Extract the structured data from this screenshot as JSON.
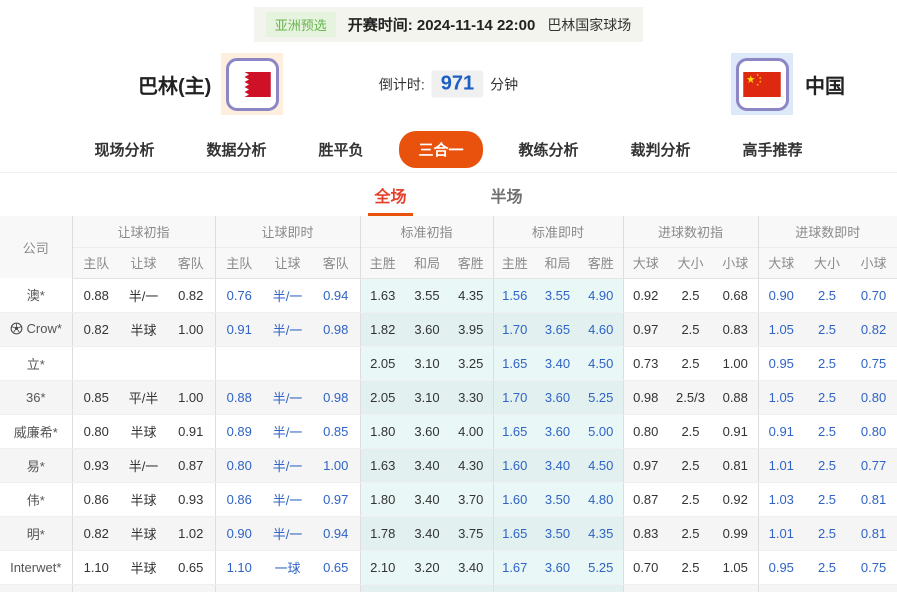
{
  "topbar": {
    "badge": "亚洲预选",
    "kickoff_label": "开赛时间:",
    "kickoff_time": "2024-11-14 22:00",
    "venue": "巴林国家球场"
  },
  "match": {
    "home_name": "巴林(主)",
    "away_name": "中国",
    "home_flag": "bahrain-flag",
    "away_flag": "china-flag",
    "countdown_label": "倒计时:",
    "countdown_value": "971",
    "countdown_unit": "分钟"
  },
  "nav": {
    "items": [
      {
        "label": "现场分析",
        "active": false
      },
      {
        "label": "数据分析",
        "active": false
      },
      {
        "label": "胜平负",
        "active": false
      },
      {
        "label": "三合一",
        "active": true
      },
      {
        "label": "教练分析",
        "active": false
      },
      {
        "label": "裁判分析",
        "active": false
      },
      {
        "label": "高手推荐",
        "active": false
      }
    ]
  },
  "subtabs": {
    "items": [
      {
        "label": "全场",
        "active": true
      },
      {
        "label": "半场",
        "active": false
      }
    ]
  },
  "table": {
    "company_header": "公司",
    "groups": [
      {
        "title": "让球初指",
        "cols": [
          "主队",
          "让球",
          "客队"
        ]
      },
      {
        "title": "让球即时",
        "cols": [
          "主队",
          "让球",
          "客队"
        ]
      },
      {
        "title": "标准初指",
        "cols": [
          "主胜",
          "和局",
          "客胜"
        ]
      },
      {
        "title": "标准即时",
        "cols": [
          "主胜",
          "和局",
          "客胜"
        ]
      },
      {
        "title": "进球数初指",
        "cols": [
          "大球",
          "大小",
          "小球"
        ]
      },
      {
        "title": "进球数即时",
        "cols": [
          "大球",
          "大小",
          "小球"
        ]
      }
    ],
    "rows": [
      {
        "company": "澳*",
        "icon": null,
        "cells": [
          [
            "0.88",
            "半/一",
            "0.82"
          ],
          [
            "0.76",
            "半/一",
            "0.94"
          ],
          [
            "1.63",
            "3.55",
            "4.35"
          ],
          [
            "1.56",
            "3.55",
            "4.90"
          ],
          [
            "0.92",
            "2.5",
            "0.68"
          ],
          [
            "0.90",
            "2.5",
            "0.70"
          ]
        ]
      },
      {
        "company": "Crow*",
        "icon": "soccer-ball",
        "cells": [
          [
            "0.82",
            "半球",
            "1.00"
          ],
          [
            "0.91",
            "半/一",
            "0.98"
          ],
          [
            "1.82",
            "3.60",
            "3.95"
          ],
          [
            "1.70",
            "3.65",
            "4.60"
          ],
          [
            "0.97",
            "2.5",
            "0.83"
          ],
          [
            "1.05",
            "2.5",
            "0.82"
          ]
        ]
      },
      {
        "company": "立*",
        "icon": null,
        "cells": [
          [
            "",
            "",
            ""
          ],
          [
            "",
            "",
            ""
          ],
          [
            "2.05",
            "3.10",
            "3.25"
          ],
          [
            "1.65",
            "3.40",
            "4.50"
          ],
          [
            "0.73",
            "2.5",
            "1.00"
          ],
          [
            "0.95",
            "2.5",
            "0.75"
          ]
        ]
      },
      {
        "company": "36*",
        "icon": null,
        "cells": [
          [
            "0.85",
            "平/半",
            "1.00"
          ],
          [
            "0.88",
            "半/一",
            "0.98"
          ],
          [
            "2.05",
            "3.10",
            "3.30"
          ],
          [
            "1.70",
            "3.60",
            "5.25"
          ],
          [
            "0.98",
            "2.5/3",
            "0.88"
          ],
          [
            "1.05",
            "2.5",
            "0.80"
          ]
        ]
      },
      {
        "company": "威廉希*",
        "icon": null,
        "cells": [
          [
            "0.80",
            "半球",
            "0.91"
          ],
          [
            "0.89",
            "半/一",
            "0.85"
          ],
          [
            "1.80",
            "3.60",
            "4.00"
          ],
          [
            "1.65",
            "3.60",
            "5.00"
          ],
          [
            "0.80",
            "2.5",
            "0.91"
          ],
          [
            "0.91",
            "2.5",
            "0.80"
          ]
        ]
      },
      {
        "company": "易*",
        "icon": null,
        "cells": [
          [
            "0.93",
            "半/一",
            "0.87"
          ],
          [
            "0.80",
            "半/一",
            "1.00"
          ],
          [
            "1.63",
            "3.40",
            "4.30"
          ],
          [
            "1.60",
            "3.40",
            "4.50"
          ],
          [
            "0.97",
            "2.5",
            "0.81"
          ],
          [
            "1.01",
            "2.5",
            "0.77"
          ]
        ]
      },
      {
        "company": "伟*",
        "icon": null,
        "cells": [
          [
            "0.86",
            "半球",
            "0.93"
          ],
          [
            "0.86",
            "半/一",
            "0.97"
          ],
          [
            "1.80",
            "3.40",
            "3.70"
          ],
          [
            "1.60",
            "3.50",
            "4.80"
          ],
          [
            "0.87",
            "2.5",
            "0.92"
          ],
          [
            "1.03",
            "2.5",
            "0.81"
          ]
        ]
      },
      {
        "company": "明*",
        "icon": null,
        "cells": [
          [
            "0.82",
            "半球",
            "1.02"
          ],
          [
            "0.90",
            "半/一",
            "0.94"
          ],
          [
            "1.78",
            "3.40",
            "3.75"
          ],
          [
            "1.65",
            "3.50",
            "4.35"
          ],
          [
            "0.83",
            "2.5",
            "0.99"
          ],
          [
            "1.01",
            "2.5",
            "0.81"
          ]
        ]
      },
      {
        "company": "Interwet*",
        "icon": null,
        "cells": [
          [
            "1.10",
            "半球",
            "0.65"
          ],
          [
            "1.10",
            "一球",
            "0.65"
          ],
          [
            "2.10",
            "3.20",
            "3.40"
          ],
          [
            "1.67",
            "3.60",
            "5.25"
          ],
          [
            "0.70",
            "2.5",
            "1.05"
          ],
          [
            "0.95",
            "2.5",
            "0.75"
          ]
        ]
      }
    ]
  },
  "colors": {
    "accent_orange": "#e8520c",
    "live_blue": "#2f63c5",
    "countdown_blue": "#1b5ec4",
    "badge_green": "#69b54e",
    "subtab_red": "#e5402a",
    "bahrain_red": "#ce1126",
    "china_red": "#de2910",
    "star_yellow": "#ffde00"
  }
}
